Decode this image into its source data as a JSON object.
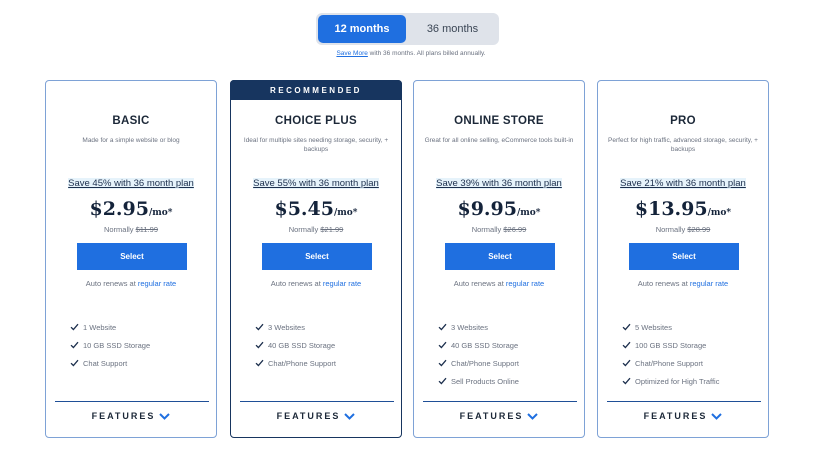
{
  "term_toggle": {
    "option_1": "12 months",
    "option_2": "36 months",
    "note_link": "Save More",
    "note_text": " with 36 months. All plans billed annually."
  },
  "colors": {
    "accent": "#1f6fe0",
    "navy": "#17355f",
    "card_border": "#7ea2d6"
  },
  "plans": [
    {
      "name": "BASIC",
      "description": "Made for a simple website or blog",
      "save": "Save 45% with 36 month plan",
      "price": "$2.95",
      "per": "/mo*",
      "normally_label": "Normally ",
      "normally_price": "$11.99",
      "cta": "Select",
      "renew_text": "Auto renews at ",
      "renew_link": "regular rate",
      "features": [
        "1 Website",
        "10 GB SSD Storage",
        "Chat Support"
      ],
      "features_label": "FEATURES"
    },
    {
      "ribbon": "RECOMMENDED",
      "name": "CHOICE PLUS",
      "description": "Ideal for multiple sites needing storage, security, + backups",
      "save": "Save 55% with 36 month plan",
      "price": "$5.45",
      "per": "/mo*",
      "normally_label": "Normally ",
      "normally_price": "$21.99",
      "cta": "Select",
      "renew_text": "Auto renews at ",
      "renew_link": "regular rate",
      "features": [
        "3 Websites",
        "40 GB SSD Storage",
        "Chat/Phone Support"
      ],
      "features_label": "FEATURES"
    },
    {
      "name": "ONLINE STORE",
      "description": "Great for all online selling, eCommerce tools built-in",
      "save": "Save 39% with 36 month plan",
      "price": "$9.95",
      "per": "/mo*",
      "normally_label": "Normally ",
      "normally_price": "$26.99",
      "cta": "Select",
      "renew_text": "Auto renews at ",
      "renew_link": "regular rate",
      "features": [
        "3 Websites",
        "40 GB SSD Storage",
        "Chat/Phone Support",
        "Sell Products Online"
      ],
      "features_label": "FEATURES"
    },
    {
      "name": "PRO",
      "description": "Perfect for high traffic, advanced storage, security, + backups",
      "save": "Save 21% with 36 month plan",
      "price": "$13.95",
      "per": "/mo*",
      "normally_label": "Normally ",
      "normally_price": "$28.99",
      "cta": "Select",
      "renew_text": "Auto renews at ",
      "renew_link": "regular rate",
      "features": [
        "5 Websites",
        "100 GB SSD Storage",
        "Chat/Phone Support",
        "Optimized for High Traffic"
      ],
      "features_label": "FEATURES"
    }
  ]
}
